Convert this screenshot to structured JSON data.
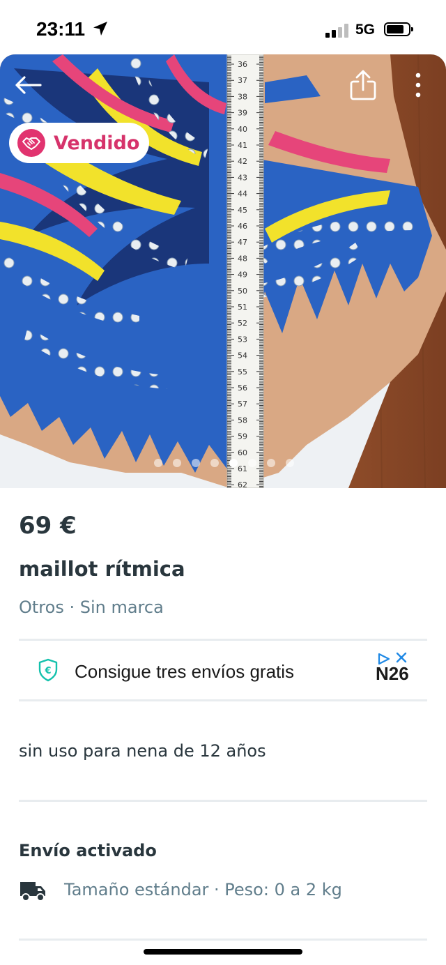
{
  "status_bar": {
    "time": "23:11",
    "network": "5G",
    "icons": [
      "location-arrow-icon",
      "signal-bars-icon",
      "battery-icon"
    ]
  },
  "gallery": {
    "badge_label": "Vendido",
    "badge_icon": "handshake-icon",
    "photo_count": 8,
    "active_photo_index": 4,
    "tape_numbers": [
      "36",
      "37",
      "38",
      "39",
      "40",
      "41",
      "42",
      "43",
      "44",
      "45",
      "46",
      "47",
      "48",
      "49",
      "50",
      "51",
      "52",
      "53",
      "54",
      "55",
      "56",
      "57",
      "58",
      "59",
      "60",
      "61",
      "62"
    ],
    "icons": [
      "back-arrow-icon",
      "share-icon",
      "more-vertical-icon"
    ]
  },
  "product": {
    "price": "69 €",
    "title": "maillot rítmica",
    "category": "Otros · Sin marca",
    "description": "sin uso para nena de 12 años"
  },
  "promo": {
    "text": "Consigue tres envíos gratis",
    "brand": "N26",
    "icons": [
      "euro-shield-icon",
      "ad-choices-icon",
      "close-icon"
    ]
  },
  "shipping": {
    "title": "Envío activado",
    "detail": "Tamaño estándar · Peso: 0 a 2 kg",
    "icon": "truck-icon"
  },
  "colors": {
    "accent": "#13c1ac",
    "sold": "#d6336b",
    "text_primary": "#29363d",
    "text_secondary": "#607d8b"
  }
}
